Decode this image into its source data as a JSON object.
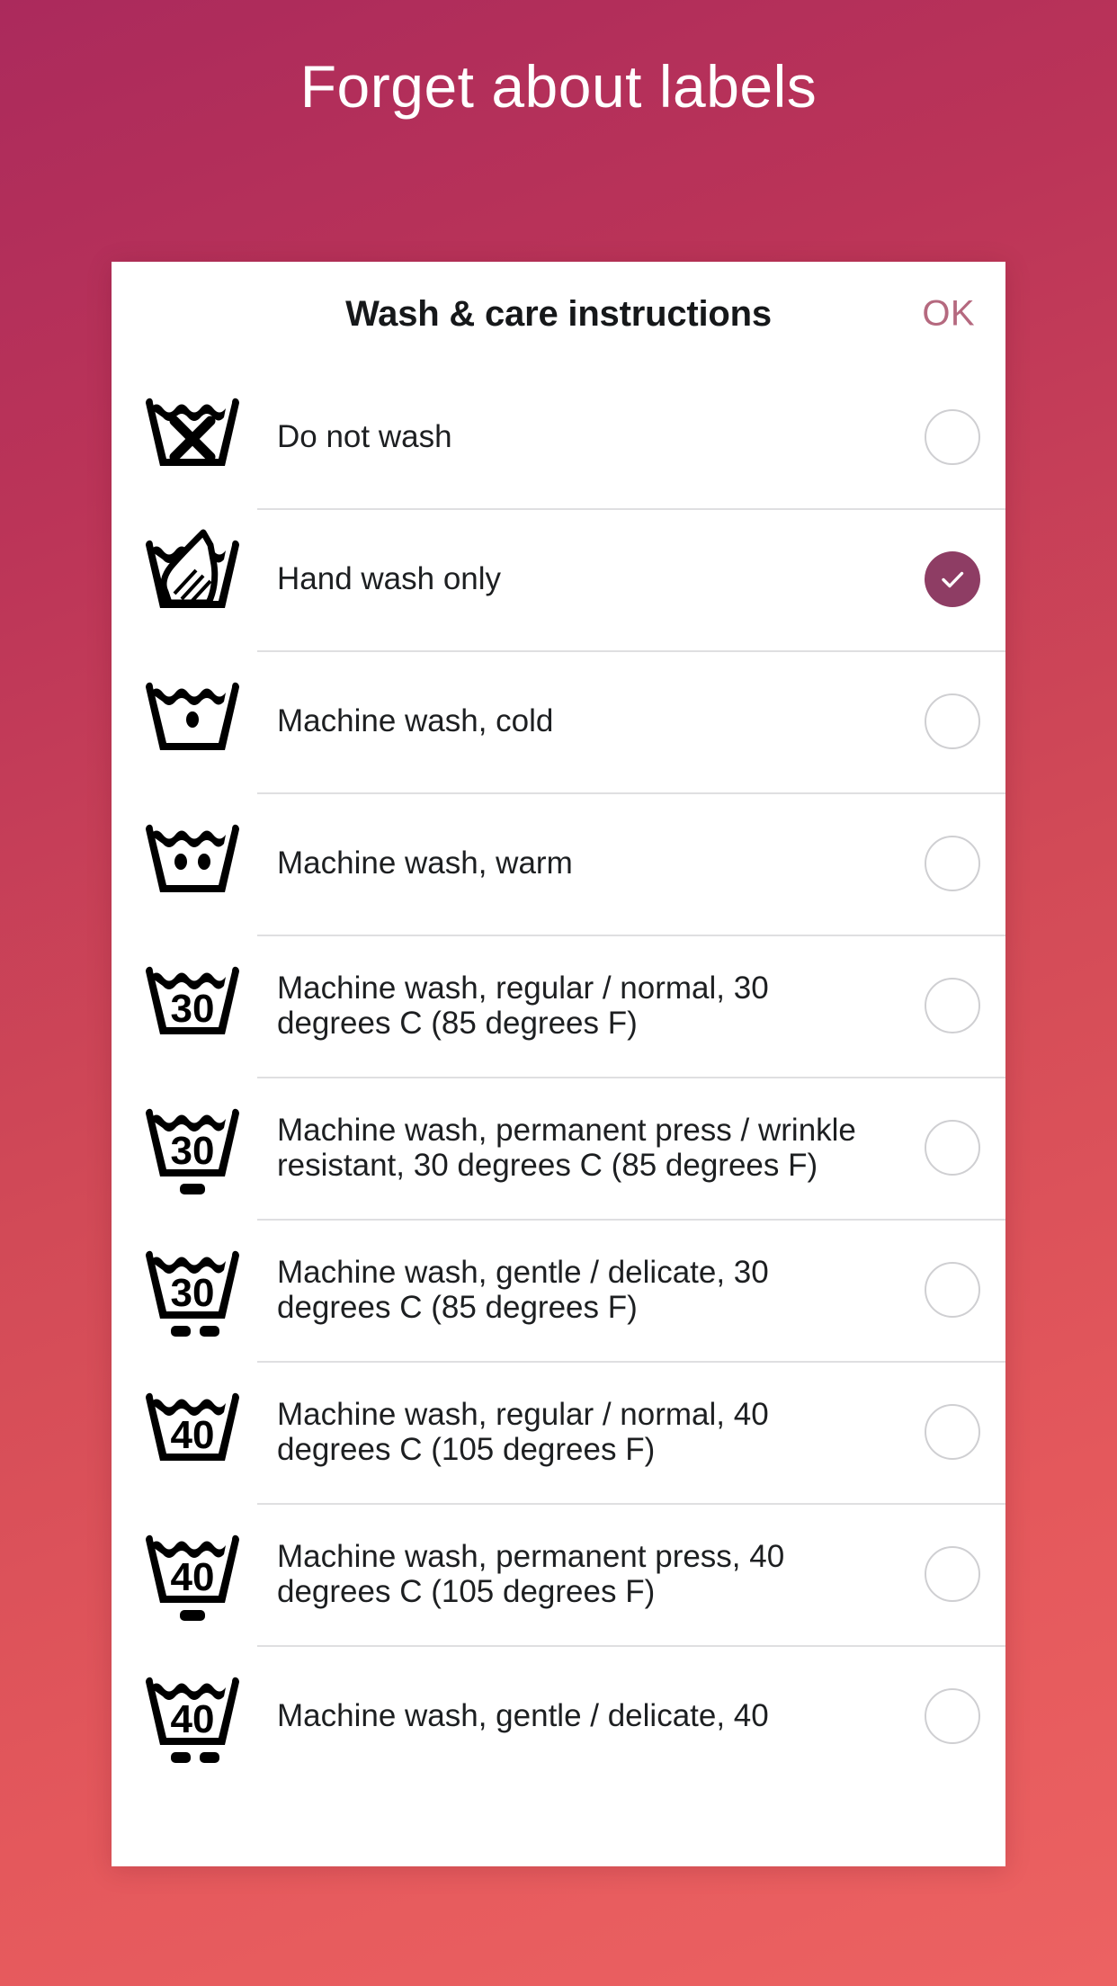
{
  "promo": {
    "headline": "Forget about labels"
  },
  "theme": {
    "background_top": "#ab2a5c",
    "background_bottom": "#ec6262",
    "card_background": "#ffffff",
    "accent_selected": "#8e3d64",
    "ok_color": "#b5697f",
    "divider": "#dfdfe1",
    "radio_border": "#cfcfd2",
    "text_color": "#1d1f21"
  },
  "dialog": {
    "title": "Wash & care instructions",
    "confirm_label": "OK"
  },
  "options": [
    {
      "icon": "do-not-wash-icon",
      "label": "Do not wash",
      "selected": false,
      "symbol": {
        "kind": "cross",
        "temp": "",
        "bars": 0
      }
    },
    {
      "icon": "hand-wash-icon",
      "label": "Hand wash only",
      "selected": true,
      "symbol": {
        "kind": "hand",
        "temp": "",
        "bars": 0
      }
    },
    {
      "icon": "machine-wash-cold-icon",
      "label": "Machine wash, cold",
      "selected": false,
      "symbol": {
        "kind": "dots1",
        "temp": "",
        "bars": 0
      }
    },
    {
      "icon": "machine-wash-warm-icon",
      "label": "Machine wash, warm",
      "selected": false,
      "symbol": {
        "kind": "dots2",
        "temp": "",
        "bars": 0
      }
    },
    {
      "icon": "machine-wash-30-normal-icon",
      "label": "Machine wash, regular / normal, 30 degrees C (85 degrees F)",
      "selected": false,
      "symbol": {
        "kind": "temp",
        "temp": "30",
        "bars": 0
      }
    },
    {
      "icon": "machine-wash-30-permanent-press-icon",
      "label": "Machine wash, permanent press / wrinkle resistant, 30 degrees C (85 degrees F)",
      "selected": false,
      "symbol": {
        "kind": "temp",
        "temp": "30",
        "bars": 1
      }
    },
    {
      "icon": "machine-wash-30-delicate-icon",
      "label": "Machine wash, gentle / delicate, 30 degrees C (85 degrees F)",
      "selected": false,
      "symbol": {
        "kind": "temp",
        "temp": "30",
        "bars": 2
      }
    },
    {
      "icon": "machine-wash-40-normal-icon",
      "label": "Machine wash, regular / normal, 40 degrees C (105 degrees F)",
      "selected": false,
      "symbol": {
        "kind": "temp",
        "temp": "40",
        "bars": 0
      }
    },
    {
      "icon": "machine-wash-40-permanent-press-icon",
      "label": "Machine wash, permanent press, 40 degrees C (105 degrees F)",
      "selected": false,
      "symbol": {
        "kind": "temp",
        "temp": "40",
        "bars": 1
      }
    },
    {
      "icon": "machine-wash-40-delicate-icon",
      "label": "Machine wash, gentle / delicate, 40",
      "selected": false,
      "symbol": {
        "kind": "temp",
        "temp": "40",
        "bars": 2
      }
    }
  ]
}
